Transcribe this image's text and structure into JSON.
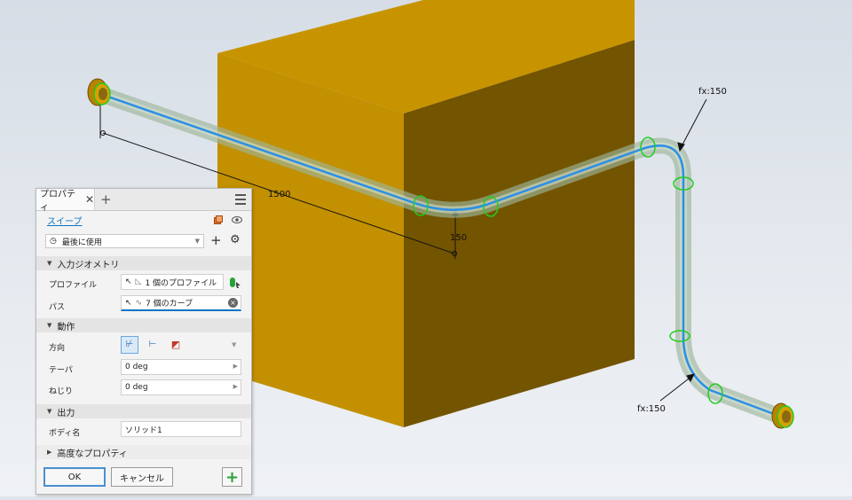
{
  "viewport": {
    "dimensions": {
      "main_length": "1500",
      "offset": "150",
      "bend_top": "fx:150",
      "bend_bottom": "fx:150"
    }
  },
  "panel": {
    "tab_title": "プロパティ",
    "tab_close": "✕",
    "tab_add": "+",
    "feature_name": "スイープ",
    "preset_dropdown": "最後に使用",
    "section_input": "入力ジオメトリ",
    "profile_label": "プロファイル",
    "profile_value": "1 個のプロファイル",
    "path_label": "パス",
    "path_value": "7 個のカーブ",
    "section_behavior": "動作",
    "orientation_label": "方向",
    "taper_label": "テーパ",
    "taper_value": "0 deg",
    "twist_label": "ねじり",
    "twist_value": "0 deg",
    "section_output": "出力",
    "body_name_label": "ボディ名",
    "body_name_value": "ソリッド1",
    "section_advanced": "高度なプロパティ",
    "ok_label": "OK",
    "cancel_label": "キャンセル",
    "apply_symbol": "+"
  },
  "colors": {
    "cube_top": "#c89500",
    "cube_front": "#735400",
    "cube_side": "#7f5d00",
    "path": "#2a8fe6",
    "profile": "#22cc22",
    "link": "#0b74c4",
    "apply_button": "#2aa13a"
  }
}
